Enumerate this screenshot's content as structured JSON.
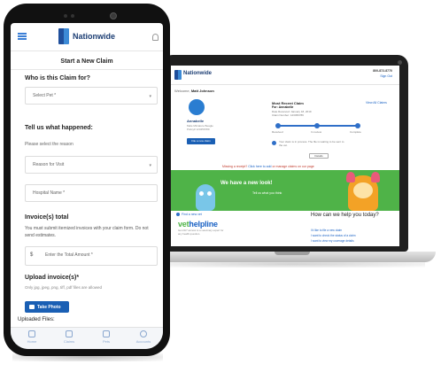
{
  "phone": {
    "brand": "Nationwide",
    "page_title": "Start a New Claim",
    "who_question": "Who is this Claim for?",
    "select_pet_placeholder": "Select Pet *",
    "what_happened_question": "Tell us what happened:",
    "reason_hint": "Please select the reason",
    "reason_placeholder": "Reason for Visit",
    "hospital_placeholder": "Hospital Name *",
    "invoice_title": "Invoice(s) total",
    "invoice_desc": "You must submit itemized invoices with your claim form. Do not send estimates.",
    "currency_symbol": "$",
    "amount_placeholder": "Enter the Total Amount *",
    "upload_title": "Upload invoice(s)*",
    "upload_hint": "Only jpg, jpeg, png, tiff, pdf files are allowed",
    "take_photo_label": "Take Photo",
    "uploaded_files_label": "Uploaded Files:",
    "tabs": [
      {
        "label": "Home",
        "icon": "home-icon"
      },
      {
        "label": "Claims",
        "icon": "claims-icon"
      },
      {
        "label": "Pets",
        "icon": "pets-icon"
      },
      {
        "label": "Accounts",
        "icon": "account-icon"
      }
    ]
  },
  "laptop": {
    "brand": "Nationwide",
    "phone_number": "800-872-8770",
    "sign_out": "Sign Out",
    "welcome_prefix": "Welcome,",
    "welcome_name": "Matt Johnson",
    "pet_name": "Annabelle",
    "pet_info": "Male Miniature Beagle Policy# 123456789",
    "pet_button": "File a new claim",
    "claim_title": "Most Recent Claim",
    "claim_for": "For: Annabelle",
    "claim_lines": "Date Received: January 18, 2019\nClaim Number: 123456789",
    "view_all": "View All Claims",
    "steps": [
      "Received",
      "In review",
      "Complete"
    ],
    "status_note": "Your claim is in process. The file is waiting to be sent to the vet.",
    "details_button": "Details",
    "add_note_prefix": "Missing a receipt?",
    "add_note_link": "Click here to add",
    "add_note_suffix": "or manage claims on our page",
    "banner_title": "We have a new look!",
    "banner_sub": "Tell us what you think",
    "find_vet": "Find a new vet",
    "vet_logo_a": "vet",
    "vet_logo_b": "helpline",
    "vet_text": "Get 24/7 access to a veterinary expert for any health question.",
    "help_title": "How can we help you today?",
    "help_links": [
      "I'd like to file a new claim",
      "I want to check the status of a claim",
      "I want to view my coverage details"
    ]
  },
  "colors": {
    "brand_blue": "#1b3d73",
    "accent_blue": "#1a5fb4",
    "banner_green": "#4fb348"
  }
}
